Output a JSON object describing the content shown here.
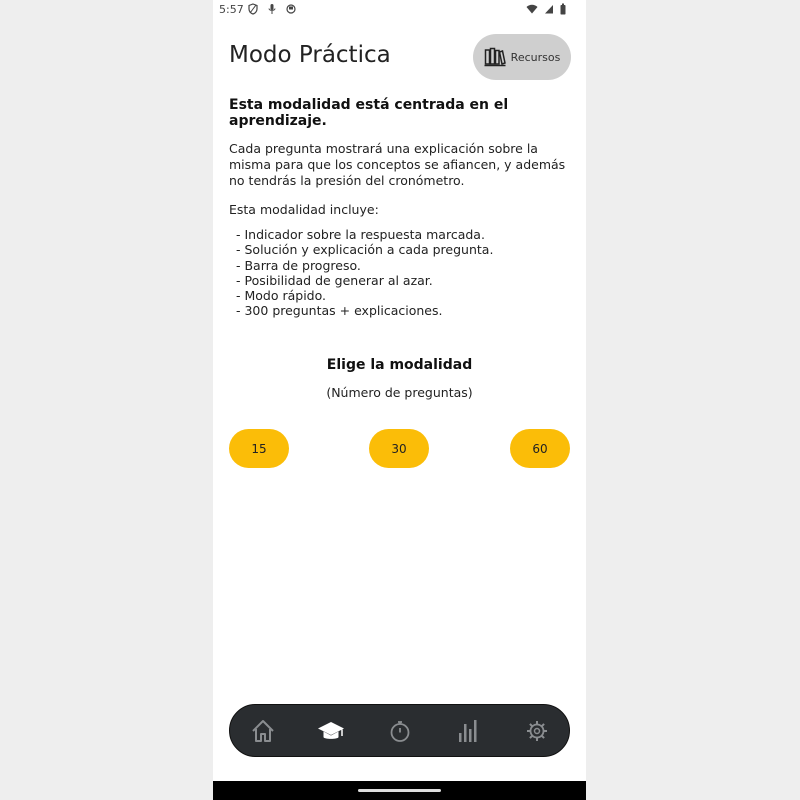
{
  "status_bar": {
    "time": "5:57",
    "left_icons": [
      "shield-icon",
      "mic-icon",
      "record-icon"
    ],
    "right_icons": [
      "wifi-icon",
      "signal-icon",
      "battery-icon"
    ]
  },
  "header": {
    "title": "Modo Práctica",
    "resources_button": {
      "label": "Recursos",
      "icon": "books-icon"
    }
  },
  "content": {
    "heading": "Esta modalidad está centrada en el aprendizaje.",
    "paragraph": "Cada pregunta mostrará una explicación sobre la misma para que los conceptos se afiancen, y además no tendrás la presión del cronómetro.",
    "includes_label": "Esta modalidad incluye:",
    "features": [
      "- Indicador sobre la respuesta marcada.",
      "- Solución y explicación a cada pregunta.",
      "- Barra de progreso.",
      "- Posibilidad de generar al azar.",
      "- Modo rápido.",
      "- 300 preguntas + explicaciones."
    ]
  },
  "mode_selection": {
    "title": "Elige la modalidad",
    "subtitle": "(Número de preguntas)",
    "options": [
      "15",
      "30",
      "60"
    ]
  },
  "bottom_nav": {
    "items": [
      "home-icon",
      "graduation-cap-icon",
      "stopwatch-icon",
      "bar-chart-icon",
      "settings-gear-icon"
    ],
    "active_index": 1
  },
  "colors": {
    "accent": "#fbbd08",
    "nav_background": "#2a2d30",
    "resources_button_bg": "#cfcfcf"
  }
}
